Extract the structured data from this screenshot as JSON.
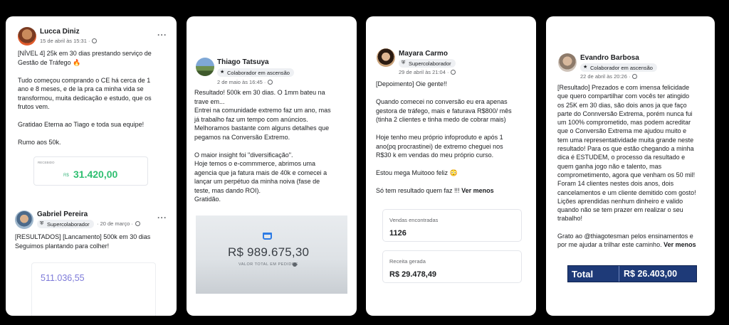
{
  "cards": [
    {
      "posts": [
        {
          "author": "Lucca Diniz",
          "meta": "15 de abril às 15:31 ·",
          "text": "[NÍVEL 4] 25k em 30 dias prestando serviço de\nGestão de Tráfego 🔥\n\nTudo começou comprando o CE há cerca de 1\nano e 8 meses, e de la pra ca minha vida se\ntransformou, muita dedicação e estudo, que os\nfrutos vem.\n\nGratidao Eterna ao Tiago e toda sua equipe!\n\nRumo aos 50k.",
          "receipt": {
            "label": "RECEBIDO",
            "currency": "R$",
            "value": "31.420,00"
          }
        },
        {
          "author": "Gabriel Pereira",
          "badge": "Supercolaborador",
          "badge_icon": "shield-icon",
          "meta": "· 20 de março ·",
          "text": "[RESULTADOS] [Lancamento] 500k em 30 dias\nSeguimos plantando para colher!",
          "value": "511.036,55"
        }
      ]
    },
    {
      "author": "Thiago Tatsuya",
      "badge": "Colaborador em ascensão",
      "badge_icon": "star-icon",
      "meta": "2 de maio às 16:45 ·",
      "text": "Resultado! 500k em 30 dias. O 1mm bateu na\ntrave em...\nEntrei na comunidade extremo faz um ano, mas\njá trabalho faz um tempo com anúncios.\nMelhoramos bastante com alguns detalhes que\npegamos na Conversão Extremo.\n\nO maior insight foi \"diversificação\".\nHoje temos o e-commmerce, abrimos uma\nagencia que ja fatura mais de 40k e comecei a\nlançar um perpétuo da minha noiva (fase de\nteste, mas dando ROI).\nGratidão.",
      "photo": {
        "value": "R$ 989.675,30",
        "caption": "VALOR TOTAL EM PEDIDOS"
      }
    },
    {
      "author": "Mayara Carmo",
      "badge": "Supercolaborador",
      "badge_icon": "shield-icon",
      "meta": "29 de abril às 21:04 ·",
      "text": "[Depoimento] Oie gente!!\n\nQuando comecei no conversão eu era apenas\ngestora de tráfego, mais e faturava R$800/ mês\n(tinha 2 clientes e tinha medo de cobrar mais)\n\nHoje tenho meu próprio infoproduto e após 1\nano(pq procrastinei) de extremo cheguei nos\nR$30 k em vendas do meu próprio curso.\n\nEstou mega Muitooo feliz 😳\n\nSó tem resultado quem faz !!!",
      "more": "Ver menos",
      "stats": [
        {
          "label": "Vendas encontradas",
          "value": "1126"
        },
        {
          "label": "Receita gerada",
          "value": "R$  29.478,49"
        }
      ]
    },
    {
      "author": "Evandro Barbosa",
      "badge": "Colaborador em ascensão",
      "badge_icon": "star-icon",
      "meta": "22 de abril às 20:26 ·",
      "text": "[Resultado] Prezados e com imensa felicidade\nque quero compartilhar com vocês ter atingido\nos 25K em 30 dias, são dois anos ja que faço\nparte do Connversão Extrema, porém nunca fui\num 100% comprometido, mas podem acreditar\nque o Conversão Extrema me ajudou muito e\ntem uma representatividade muita grande neste\nresultado! Para os que estão chegando a minha\ndica é ESTUDEM, o processo da resultado e\nquem ganha jogo não e talento, mas\ncomprometimento, agora que venham os 50 mil!\nForam 14 clientes nestes dois anos, dois\ncancelamentos e um cliente demitido com gosto!\nLições aprendidas nenhum dinheiro e valido\nquando não se tem prazer em realizar o seu\ntrabalho!\n\nGrato ao @thiagotesman pelos ensinamentos e\npor me ajudar a trilhar este caminho.",
      "more": "Ver menos",
      "total": {
        "label": "Total",
        "value": "R$  26.403,00"
      }
    }
  ],
  "ui": {
    "more_options": "···"
  }
}
